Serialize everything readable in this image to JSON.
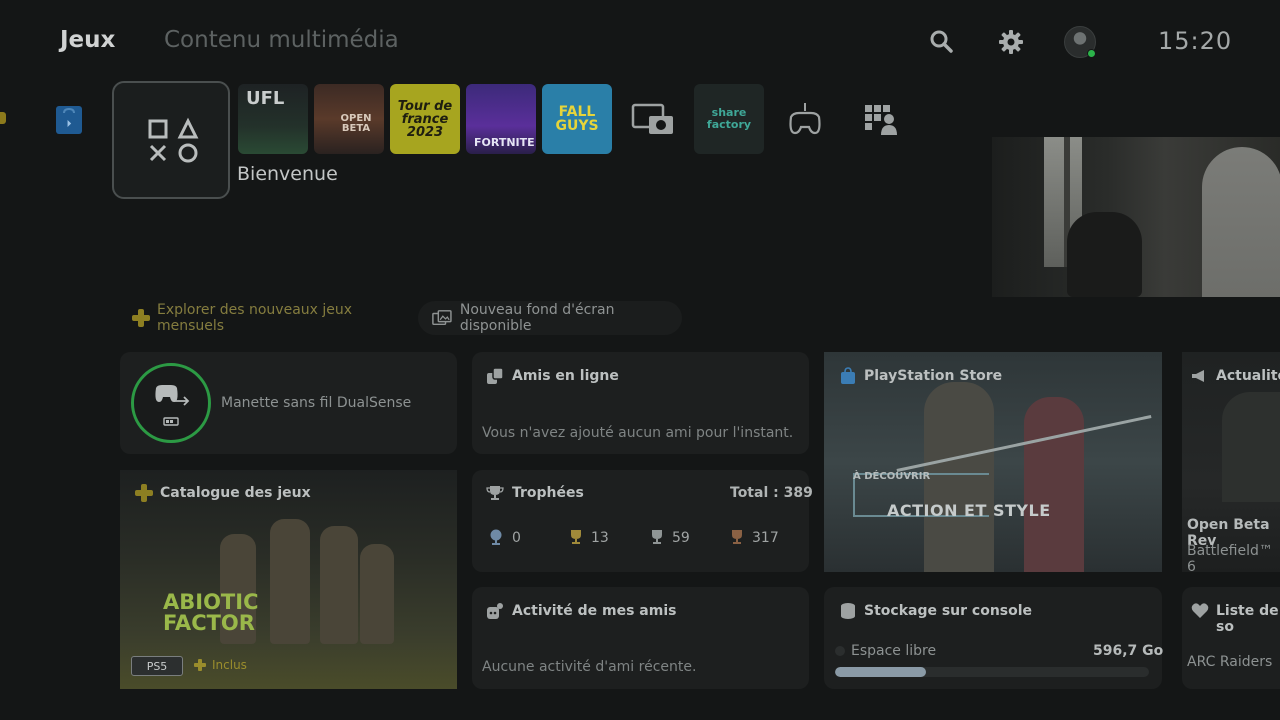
{
  "header": {
    "tabs": [
      {
        "label": "Jeux",
        "active": true
      },
      {
        "label": "Contenu multimédia",
        "active": false
      }
    ],
    "icons": [
      "search-icon",
      "gear-icon",
      "avatar"
    ],
    "clock": "15:20",
    "online_color": "#2cb34a"
  },
  "launcher": {
    "welcome_label": "Bienvenue",
    "tiles": [
      {
        "name": "ufl",
        "text": "UFL"
      },
      {
        "name": "battlefield-open-beta",
        "text": "OPEN BETA"
      },
      {
        "name": "tour-de-france",
        "text": "Tour de france 2023"
      },
      {
        "name": "fortnite",
        "text": "FORTNITE"
      },
      {
        "name": "fall-guys",
        "text": "FALL GUYS"
      },
      {
        "name": "media-gallery",
        "icon": "camera-gallery-icon"
      },
      {
        "name": "share-factory",
        "text": "share factory"
      },
      {
        "name": "game-library",
        "icon": "controller-icon"
      },
      {
        "name": "game-base",
        "icon": "grid-person-icon"
      }
    ]
  },
  "banners": {
    "plus": "Explorer des nouveaux jeux mensuels",
    "wallpaper": "Nouveau fond d'écran disponible"
  },
  "cards": {
    "controller": {
      "label": "Manette sans fil DualSense",
      "ring_color": "#2c9a44"
    },
    "friends": {
      "title": "Amis en ligne",
      "text": "Vous n'avez ajouté aucun ami pour l'instant."
    },
    "store": {
      "title": "PlayStation Store",
      "kicker": "À DÉCOUVRIR",
      "headline": "ACTION ET STYLE"
    },
    "news": {
      "title": "Actualités",
      "line1": "Open Beta Rev",
      "line2": "Battlefield™ 6"
    },
    "catalog": {
      "title": "Catalogue des jeux",
      "game_line1": "ABIOTIC",
      "game_line2": "FACTOR",
      "platform": "PS5",
      "included": "Inclus"
    },
    "trophies": {
      "title": "Trophées",
      "total": "Total : 389",
      "counts": [
        {
          "type": "platinum",
          "value": "0"
        },
        {
          "type": "gold",
          "value": "13"
        },
        {
          "type": "silver",
          "value": "59"
        },
        {
          "type": "bronze",
          "value": "317"
        }
      ]
    },
    "activity": {
      "title": "Activité de mes amis",
      "text": "Aucune activité d'ami récente."
    },
    "storage": {
      "title": "Stockage sur console",
      "label": "Espace libre",
      "value": "596,7 Go",
      "used_fraction": 0.29
    },
    "wishlist": {
      "title": "Liste de so",
      "item": "ARC Raiders"
    }
  }
}
